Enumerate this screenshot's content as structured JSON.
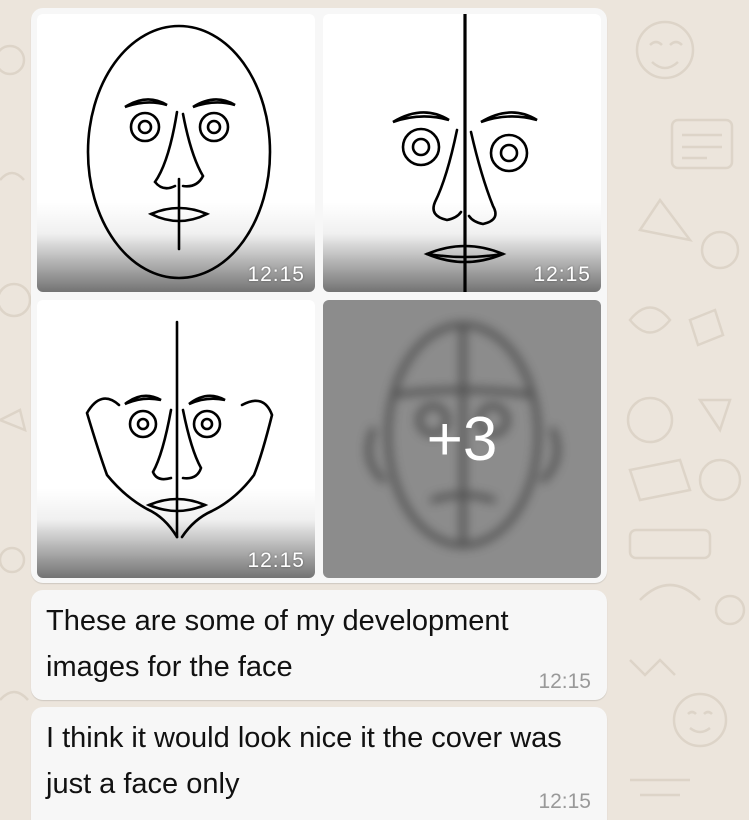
{
  "conversation": {
    "album": {
      "photos": [
        {
          "time": "12:15",
          "icon": "face-drawing-oval"
        },
        {
          "time": "12:15",
          "icon": "face-drawing-split"
        },
        {
          "time": "12:15",
          "icon": "face-drawing-ears"
        }
      ],
      "more": {
        "count_label": "+3",
        "icon": "face-drawing-blurred"
      }
    },
    "messages": [
      {
        "text": "These are some of my development images for the face",
        "time": "12:15"
      },
      {
        "text": "I think it would look nice it the cover was just a face only",
        "time": "12:15"
      }
    ]
  },
  "colors": {
    "wallpaper": "#ece5dc",
    "bubble": "#f7f7f7",
    "more_overlay": "#8c8c8c",
    "time_text": "#999999"
  }
}
